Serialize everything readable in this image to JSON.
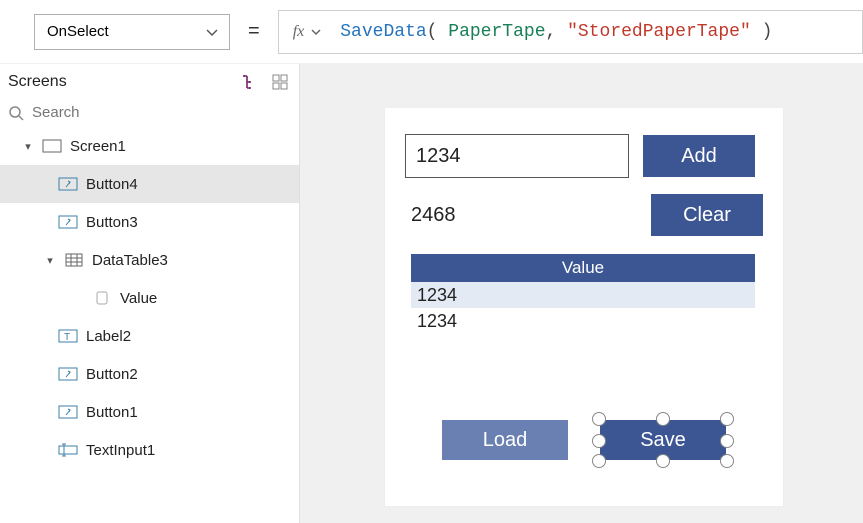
{
  "topbar": {
    "property": "OnSelect",
    "equals": "=",
    "fx": "fx",
    "formula": {
      "fn": "SaveData",
      "open": "(",
      "arg1": "PaperTape",
      "comma": ",",
      "arg2": "\"StoredPaperTape\"",
      "close": ")"
    }
  },
  "sidebar": {
    "title": "Screens",
    "search_placeholder": "Search",
    "items": [
      {
        "label": "Screen1"
      },
      {
        "label": "Button4"
      },
      {
        "label": "Button3"
      },
      {
        "label": "DataTable3"
      },
      {
        "label": "Value"
      },
      {
        "label": "Label2"
      },
      {
        "label": "Button2"
      },
      {
        "label": "Button1"
      },
      {
        "label": "TextInput1"
      }
    ]
  },
  "app": {
    "input_value": "1234",
    "add_label": "Add",
    "result": "2468",
    "clear_label": "Clear",
    "table_header": "Value",
    "rows": [
      "1234",
      "1234"
    ],
    "load_label": "Load",
    "save_label": "Save"
  }
}
